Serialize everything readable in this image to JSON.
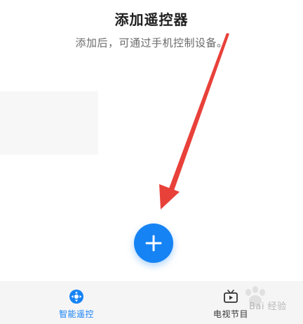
{
  "header": {
    "title": "添加遥控器",
    "subtitle": "添加后，可通过手机控制设备。"
  },
  "add_button": {
    "icon": "plus-icon",
    "color": "#1683f4"
  },
  "annotation": {
    "arrow_color": "#e8413a"
  },
  "bottom_nav": {
    "items": [
      {
        "label": "智能遥控",
        "icon": "remote-control-icon",
        "active": true
      },
      {
        "label": "电视节目",
        "icon": "tv-icon",
        "active": false
      }
    ],
    "active_color": "#1683f4"
  },
  "watermark": {
    "text": "Bai 经验"
  }
}
